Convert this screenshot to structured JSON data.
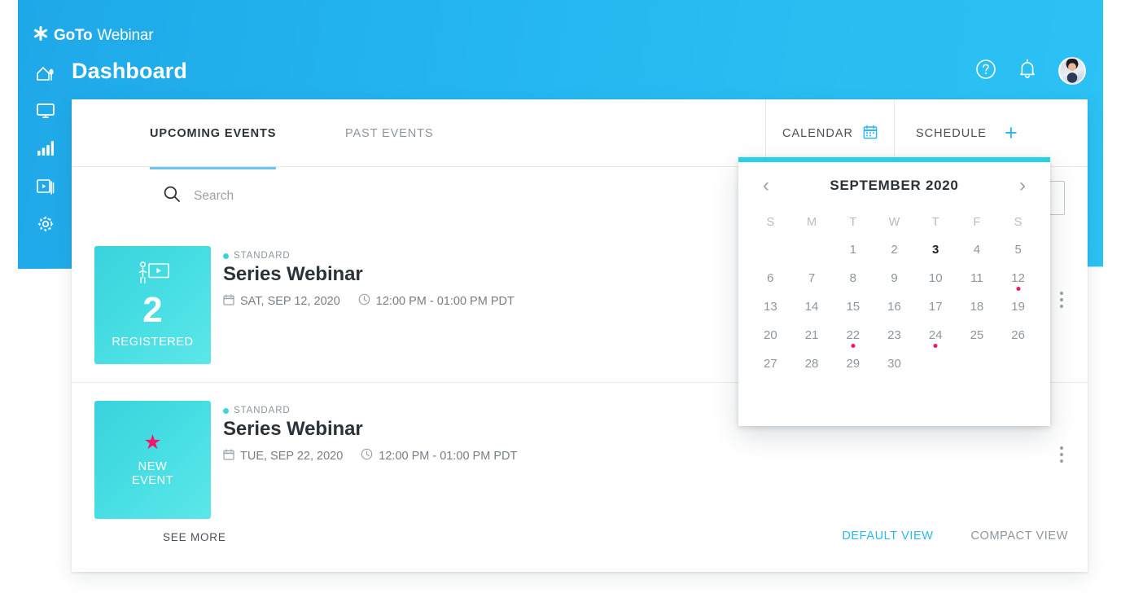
{
  "brand": {
    "bold": "GoTo",
    "light": "Webinar",
    "logo_icon": "asterisk-logo-icon"
  },
  "header": {
    "title": "Dashboard",
    "help_icon": "help-circle-icon",
    "notifications_icon": "bell-icon",
    "avatar_label": "user-avatar"
  },
  "sidebar": {
    "items": [
      {
        "icon": "home-icon",
        "name": "dashboard"
      },
      {
        "icon": "monitor-icon",
        "name": "webinars"
      },
      {
        "icon": "bar-chart-icon",
        "name": "analytics"
      },
      {
        "icon": "video-library-icon",
        "name": "recordings"
      },
      {
        "icon": "gear-icon",
        "name": "settings"
      }
    ]
  },
  "tabs": [
    {
      "label": "UPCOMING EVENTS",
      "active": true
    },
    {
      "label": "PAST EVENTS",
      "active": false
    }
  ],
  "header_actions": {
    "calendar_label": "CALENDAR",
    "calendar_icon": "calendar-icon",
    "schedule_label": "SCHEDULE",
    "schedule_icon": "plus-icon"
  },
  "search": {
    "placeholder": "Search",
    "value": "",
    "icon": "search-icon"
  },
  "filter": {
    "value": ""
  },
  "events": [
    {
      "tile": {
        "icon": "presenter-screen-icon",
        "count": "2",
        "label": "REGISTERED",
        "type": "count"
      },
      "badge": "STANDARD",
      "title": "Series Webinar",
      "date": "SAT, SEP 12, 2020",
      "time": "12:00 PM - 01:00 PM PDT",
      "date_icon": "calendar-icon",
      "time_icon": "clock-icon",
      "menu_icon": "kebab-menu-icon"
    },
    {
      "tile": {
        "icon": "star-icon",
        "label_line1": "NEW",
        "label_line2": "EVENT",
        "type": "new"
      },
      "badge": "STANDARD",
      "title": "Series Webinar",
      "date": "TUE, SEP 22, 2020",
      "time": "12:00 PM - 01:00 PM PDT",
      "date_icon": "calendar-icon",
      "time_icon": "clock-icon",
      "menu_icon": "kebab-menu-icon"
    }
  ],
  "footer": {
    "see_more": "SEE MORE",
    "default_view": "DEFAULT VIEW",
    "compact_view": "COMPACT VIEW"
  },
  "calendar_popup": {
    "month_title": "SEPTEMBER 2020",
    "prev_icon": "chevron-left-icon",
    "next_icon": "chevron-right-icon",
    "day_headers": [
      "S",
      "M",
      "T",
      "W",
      "T",
      "F",
      "S"
    ],
    "leading_blanks": 2,
    "days": [
      {
        "n": "1"
      },
      {
        "n": "2"
      },
      {
        "n": "3",
        "today": true
      },
      {
        "n": "4"
      },
      {
        "n": "5"
      },
      {
        "n": "6"
      },
      {
        "n": "7"
      },
      {
        "n": "8"
      },
      {
        "n": "9"
      },
      {
        "n": "10"
      },
      {
        "n": "11"
      },
      {
        "n": "12",
        "event": true
      },
      {
        "n": "13"
      },
      {
        "n": "14"
      },
      {
        "n": "15"
      },
      {
        "n": "16"
      },
      {
        "n": "17"
      },
      {
        "n": "18"
      },
      {
        "n": "19"
      },
      {
        "n": "20"
      },
      {
        "n": "21"
      },
      {
        "n": "22",
        "event": true
      },
      {
        "n": "23"
      },
      {
        "n": "24",
        "event": true
      },
      {
        "n": "25"
      },
      {
        "n": "26"
      },
      {
        "n": "27"
      },
      {
        "n": "28"
      },
      {
        "n": "29"
      },
      {
        "n": "30"
      }
    ]
  },
  "colors": {
    "brand_blue": "#29BDF2",
    "accent_cyan": "#27D3E2",
    "event_pink": "#F5156C",
    "link_blue": "#2AB7F0",
    "tile_teal": "#3FD8DE"
  }
}
